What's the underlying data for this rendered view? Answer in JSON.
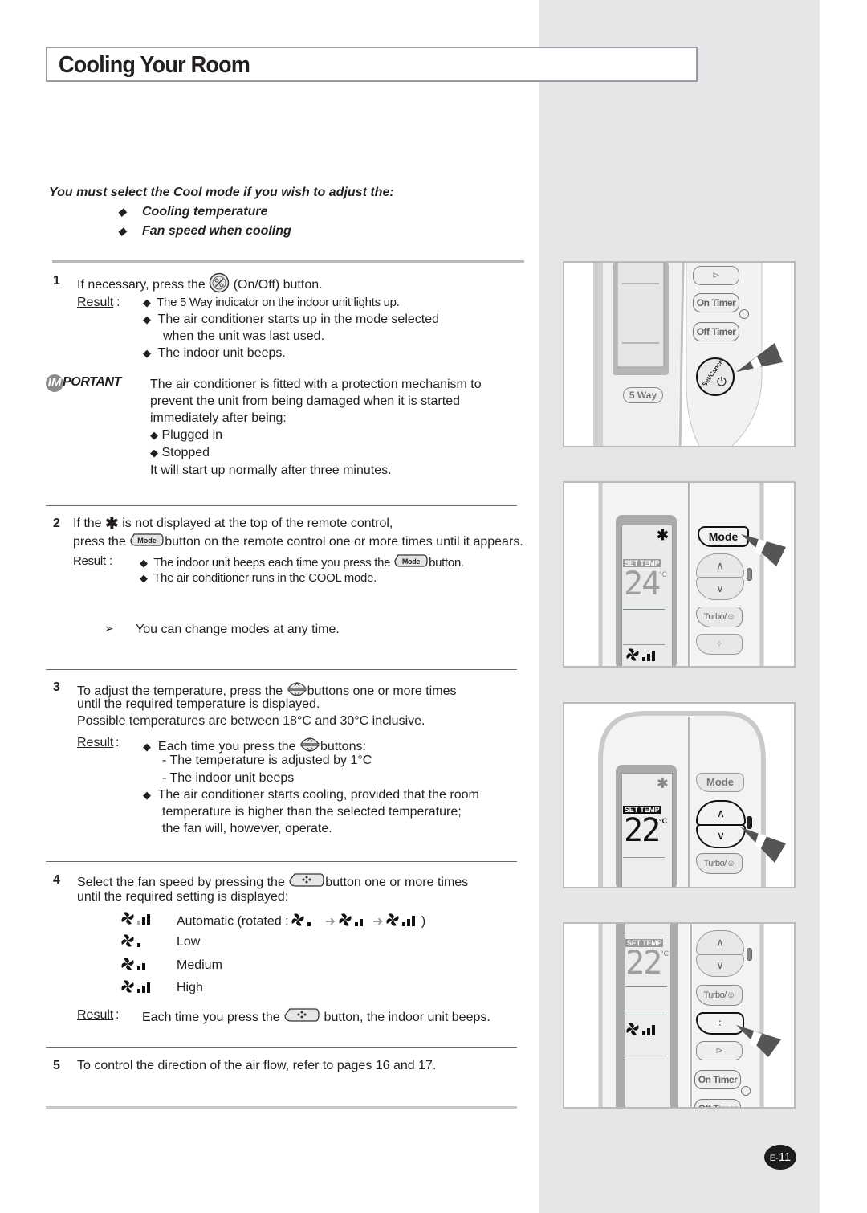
{
  "page": {
    "title": "Cooling Your Room",
    "page_number_prefix": "E-",
    "page_number": "11"
  },
  "intro": {
    "lead": "You must select the Cool mode if you wish to adjust the:",
    "bullets": [
      "Cooling temperature",
      "Fan speed when cooling"
    ]
  },
  "symbols": {
    "diamond": "◆",
    "arrow": "➢"
  },
  "step1": {
    "number": "1",
    "text_before": "If necessary, press the",
    "text_after": "(On/Off) button.",
    "result_label": "Result",
    "results": [
      "The 5 Way indicator on the indoor unit lights up.",
      "The air conditioner starts up in the mode selected",
      "when the unit was last used.",
      "The indoor unit beeps."
    ],
    "important": {
      "logo_letter": "IM",
      "logo_text": "PORTANT",
      "lines": [
        "The air conditioner is fitted with a protection mechanism to",
        "prevent the unit from being damaged when it is started",
        "immediately after being:"
      ],
      "bullets": [
        "Plugged in",
        "Stopped"
      ],
      "footer": "It will start up normally after three minutes."
    }
  },
  "step2": {
    "number": "2",
    "line1_before": "If the",
    "line1_after": "is not displayed at the top of the remote control,",
    "line2_before": "press the",
    "line2_after": "button on the remote control one or more times until it appears.",
    "mode_label": "Mode",
    "result_label": "Result",
    "result1_before": "The indoor unit beeps each time you press the",
    "result1_after": "button.",
    "result2": "The air conditioner runs in the COOL mode.",
    "note": "You can change modes at any time."
  },
  "step3": {
    "number": "3",
    "line1_before": "To adjust the temperature, press the",
    "line1_after": "buttons one or more times",
    "line2": "until the required temperature is displayed.",
    "line3": "Possible temperatures are between 18°C and 30°C inclusive.",
    "result_label": "Result",
    "result1_before": "Each time you press the",
    "result1_after": "buttons:",
    "sub1": "- The temperature is adjusted by 1°C",
    "sub2": "- The indoor unit beeps",
    "result2_lines": [
      "The air conditioner starts cooling, provided that the room",
      "temperature is higher than the selected temperature;",
      "the fan will, however, operate."
    ]
  },
  "step4": {
    "number": "4",
    "line1_before": "Select the fan speed by pressing the",
    "line1_after": "button one or more times",
    "line2": "until the required setting is displayed:",
    "fan_speeds": [
      {
        "label": "Automatic (rotated :",
        "suffix": ")",
        "bars": 3,
        "auto": true
      },
      {
        "label": "Low",
        "bars": 1
      },
      {
        "label": "Medium",
        "bars": 2
      },
      {
        "label": "High",
        "bars": 3
      }
    ],
    "result_label": "Result",
    "result_before": "Each time you press the",
    "result_after": "button, the indoor unit beeps."
  },
  "step5": {
    "number": "5",
    "text": "To control the direction of the air flow, refer to pages 16 and 17."
  },
  "remotes": {
    "panel1": {
      "buttons": [
        "On Timer",
        "Off Timer"
      ],
      "set_cancel": "Set/Cancel",
      "indicator": "5 Way"
    },
    "panel2": {
      "set_temp_label": "SET TEMP",
      "temperature": "24",
      "unit": "°C",
      "buttons": [
        "Mode",
        "Turbo/"
      ]
    },
    "panel3": {
      "set_temp_label": "SET TEMP",
      "temperature": "22",
      "unit": "°C",
      "buttons": [
        "Mode",
        "Turbo/"
      ]
    },
    "panel4": {
      "set_temp_label": "SET TEMP",
      "temperature": "22",
      "unit": "°C",
      "buttons": [
        "Turbo/",
        "On Timer",
        "Off Timer"
      ]
    }
  },
  "colors": {
    "side_band": "#e5e6e8",
    "panel_border": "#b9babc",
    "pointer": "#555555",
    "lcd_bg": "#e8e9e9",
    "lcd_frame": "#a8a9ab"
  }
}
